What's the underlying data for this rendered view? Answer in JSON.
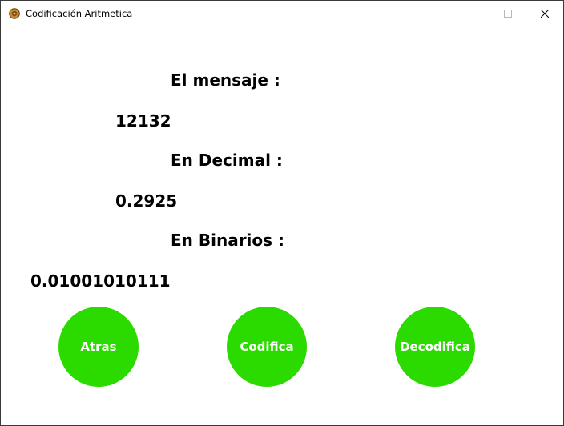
{
  "window": {
    "title": "Codificación Aritmetica",
    "icon": "app-globe-icon",
    "controls": [
      "minimize-icon",
      "maximize-icon",
      "close-icon"
    ]
  },
  "content": {
    "message_label": "El mensaje :",
    "message_value": "12132",
    "decimal_label": "En Decimal :",
    "decimal_value": "0.2925",
    "binary_label": "En Binarios :",
    "binary_value": "0.01001010111"
  },
  "buttons": {
    "back": "Atras",
    "encode": "Codifica",
    "decode": "Decodifica"
  },
  "colors": {
    "button_fill": "#2bdb00",
    "button_text": "#ffffff",
    "text": "#000000",
    "background": "#ffffff"
  }
}
